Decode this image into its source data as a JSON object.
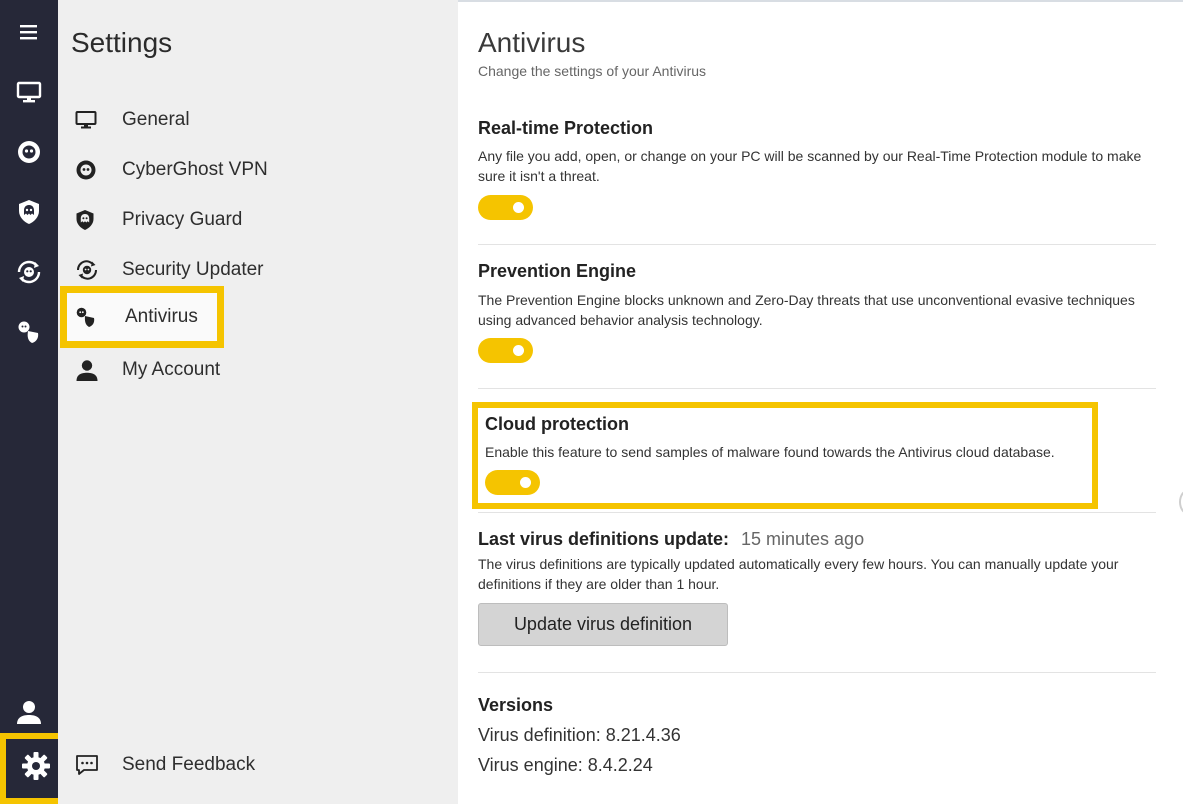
{
  "sidebar_rail": {
    "icons": [
      "menu-icon",
      "monitor-icon",
      "ghost-icon",
      "shield-icon",
      "updater-icon",
      "antivirus-icon",
      "user-icon",
      "gear-icon"
    ]
  },
  "settings_nav": {
    "title": "Settings",
    "items": [
      {
        "label": "General",
        "icon": "monitor-icon"
      },
      {
        "label": "CyberGhost VPN",
        "icon": "ghost-icon"
      },
      {
        "label": "Privacy Guard",
        "icon": "shield-icon"
      },
      {
        "label": "Security Updater",
        "icon": "updater-icon"
      },
      {
        "label": "Antivirus",
        "icon": "antivirus-icon",
        "active": true
      },
      {
        "label": "My Account",
        "icon": "user-icon"
      }
    ],
    "feedback_label": "Send Feedback"
  },
  "main": {
    "title": "Antivirus",
    "subtitle": "Change the settings of your Antivirus",
    "sections": [
      {
        "title": "Real-time Protection",
        "description": "Any file you add, open, or change on your PC will be scanned by our Real-Time Protection module to make sure it isn't a threat.",
        "enabled": true
      },
      {
        "title": "Prevention Engine",
        "description": "The Prevention Engine blocks unknown and Zero-Day threats that use unconventional evasive techniques using advanced behavior analysis technology.",
        "enabled": true
      },
      {
        "title": "Cloud protection",
        "description": "Enable this feature to send samples of malware found towards the Antivirus cloud database.",
        "enabled": true
      }
    ],
    "last_update": {
      "label": "Last virus definitions update:",
      "value": "15 minutes ago",
      "description": "The virus definitions are typically updated automatically every few hours. You can manually update your definitions if they are older than 1 hour.",
      "button_label": "Update virus definition"
    },
    "versions": {
      "title": "Versions",
      "definition": "Virus definition: 8.21.4.36",
      "engine": "Virus engine: 8.4.2.24"
    }
  },
  "colors": {
    "accent": "#f5c400",
    "rail": "#262838",
    "nav_bg": "#efefef"
  }
}
